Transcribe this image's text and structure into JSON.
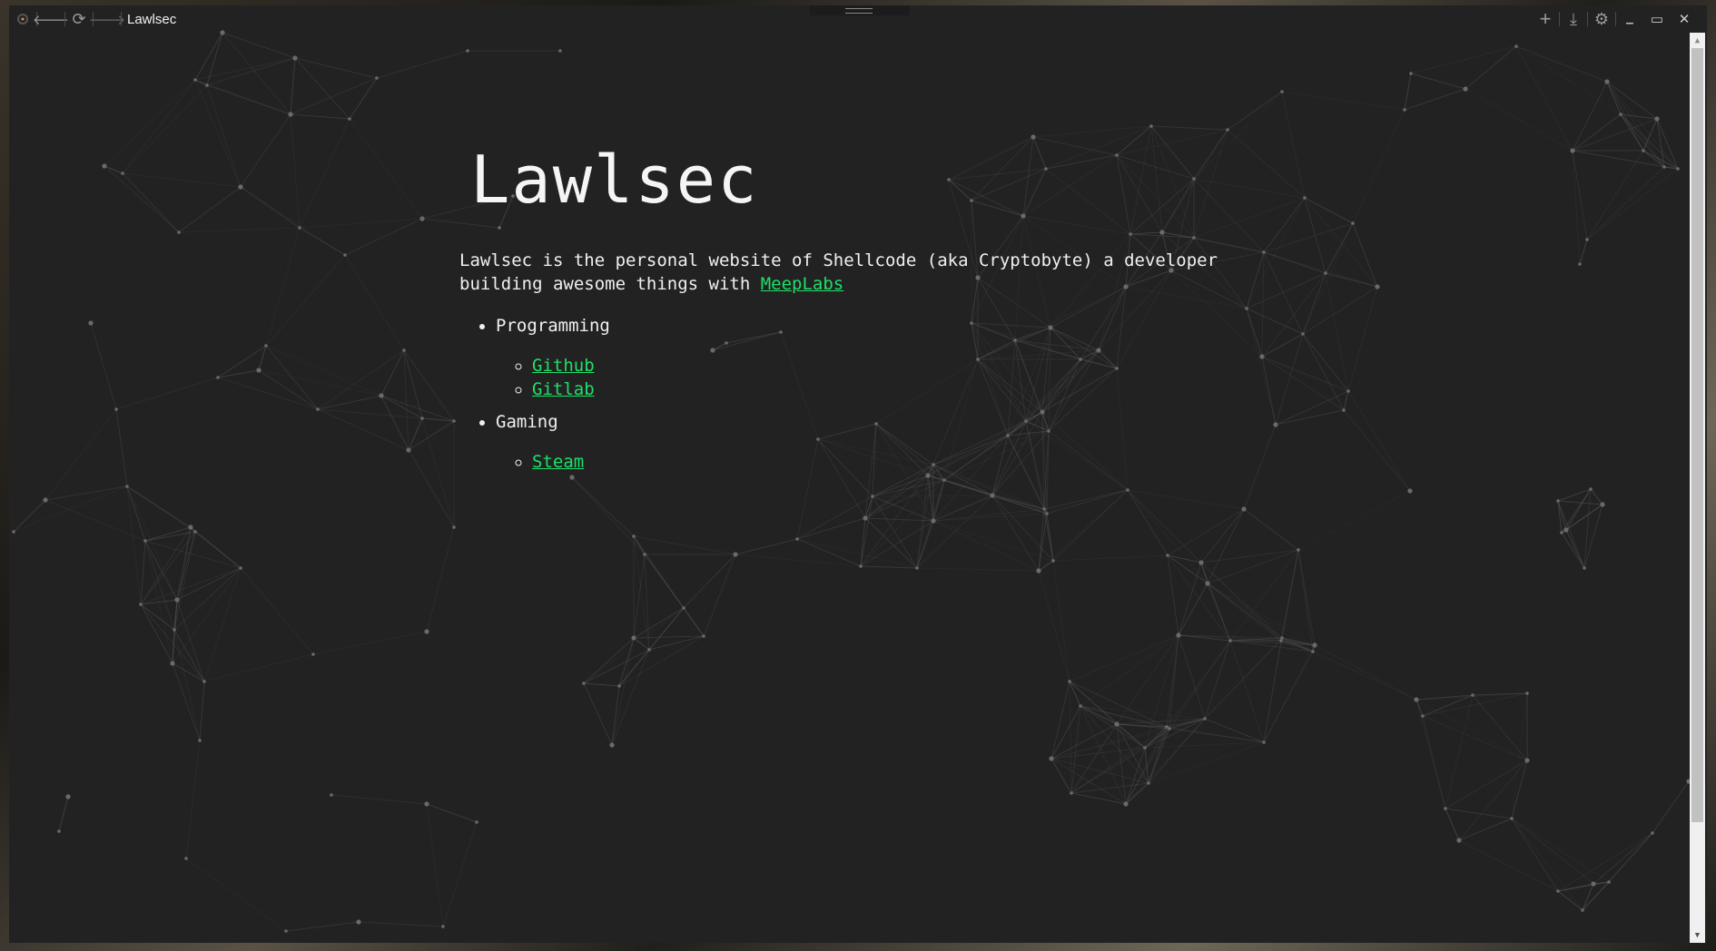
{
  "browser": {
    "title": "Lawlsec",
    "icons": {
      "app": "app-logo-icon",
      "back": "arrow-left-icon",
      "reload": "reload-icon",
      "forward": "arrow-right-icon",
      "new_tab": "plus-icon",
      "download": "download-icon",
      "settings": "gear-icon",
      "minimize": "minimize-icon",
      "maximize": "maximize-icon",
      "close": "close-icon"
    },
    "glyphs": {
      "back": "🡐",
      "reload": "⟳",
      "forward": "🡒",
      "new_tab": "+",
      "download": "⤓",
      "settings": "⚙",
      "minimize": "▁",
      "maximize": "▭",
      "close": "✕",
      "scroll_up": "▲",
      "scroll_down": "▼"
    },
    "scroll_position": 0.0
  },
  "page": {
    "heading": "Lawlsec",
    "intro_prefix": "Lawlsec is the personal website of Shellcode (aka Cryptobyte) a developer building awesome things with ",
    "intro_link": "MeepLabs",
    "sections": [
      {
        "label": "Programming",
        "links": [
          "Github",
          "Gitlab"
        ]
      },
      {
        "label": "Gaming",
        "links": [
          "Steam"
        ]
      }
    ]
  },
  "colors": {
    "background": "#222222",
    "text": "#f0f0f0",
    "link": "#1ee06a",
    "network": "#5a5a5a"
  }
}
